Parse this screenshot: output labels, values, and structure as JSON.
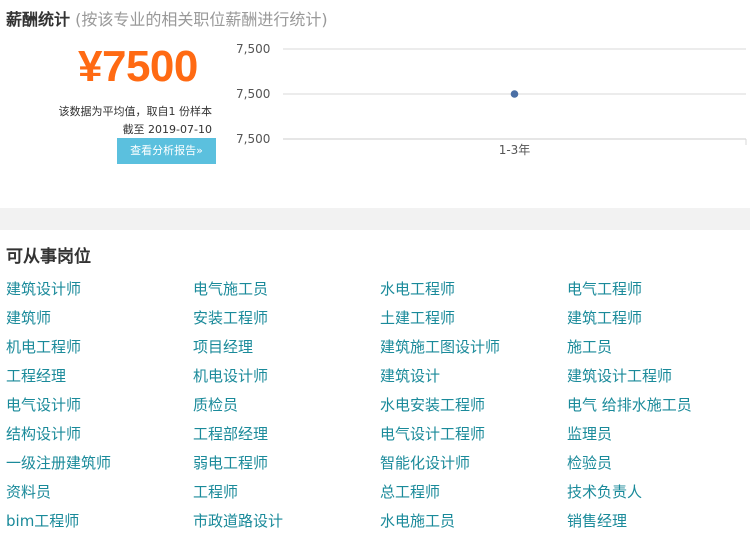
{
  "salary": {
    "title": "薪酬统计",
    "subtitle": "(按该专业的相关职位薪酬进行统计)",
    "amount": "¥7500",
    "note_avg": "该数据为平均值，取自1 份样本",
    "note_date": "截至 2019-07-10",
    "report_button": "查看分析报告»"
  },
  "chart_data": {
    "type": "line",
    "categories": [
      "1-3年"
    ],
    "series": [
      {
        "values": [
          7500
        ]
      }
    ],
    "y_tick_labels": [
      "7,500",
      "7,500",
      "7,500"
    ],
    "grid": true,
    "colors": {
      "point": "#4a6fa5",
      "grid": "#d8d8d8"
    }
  },
  "jobs": {
    "title": "可从事岗位",
    "columns": [
      [
        "建筑设计师",
        "建筑师",
        "机电工程师",
        "工程经理",
        "电气设计师",
        "结构设计师",
        "一级注册建筑师",
        "资料员",
        "bim工程师"
      ],
      [
        "电气施工员",
        "安装工程师",
        "项目经理",
        "机电设计师",
        "质检员",
        "工程部经理",
        "弱电工程师",
        "工程师",
        "市政道路设计"
      ],
      [
        "水电工程师",
        "土建工程师",
        "建筑施工图设计师",
        "建筑设计",
        "水电安装工程师",
        "电气设计工程师",
        "智能化设计师",
        "总工程师",
        "水电施工员"
      ],
      [
        "电气工程师",
        "建筑工程师",
        "施工员",
        "建筑设计工程师",
        "电气 给排水施工员",
        "监理员",
        "检验员",
        "技术负责人",
        "销售经理"
      ]
    ]
  }
}
